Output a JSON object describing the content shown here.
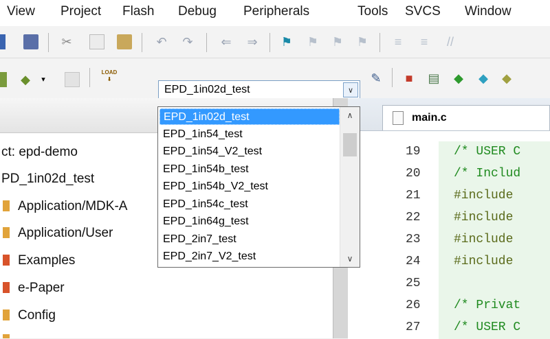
{
  "menu": [
    {
      "label": "View",
      "id": "view"
    },
    {
      "label": "Project",
      "id": "project"
    },
    {
      "label": "Flash",
      "id": "flash"
    },
    {
      "label": "Debug",
      "id": "debug"
    },
    {
      "label": "Peripherals",
      "id": "peripherals"
    },
    {
      "label": "Tools",
      "id": "tools"
    },
    {
      "label": "SVCS",
      "id": "svcs"
    },
    {
      "label": "Window",
      "id": "window"
    }
  ],
  "toolbar2": {
    "load_label": "LOAD",
    "target_value": "EPD_1in02d_test"
  },
  "dropdown": {
    "options": [
      "EPD_1in02d_test",
      "EPD_1in54_test",
      "EPD_1in54_V2_test",
      "EPD_1in54b_test",
      "EPD_1in54b_V2_test",
      "EPD_1in54c_test",
      "EPD_1in64g_test",
      "EPD_2in7_test",
      "EPD_2in7_V2_test"
    ],
    "selected_index": 0
  },
  "project_tree": {
    "project_label": "ct: epd-demo",
    "target_label": "PD_1in02d_test",
    "groups": [
      {
        "label": "Application/MDK-A",
        "color": "#e1a33a"
      },
      {
        "label": "Application/User",
        "color": "#e1a33a"
      },
      {
        "label": "Examples",
        "color": "#d8532a"
      },
      {
        "label": "e-Paper",
        "color": "#d8532a"
      },
      {
        "label": "Config",
        "color": "#e1a33a"
      }
    ]
  },
  "editor": {
    "tab_label": "main.c",
    "lines": [
      {
        "num": "19",
        "text": "/* USER C",
        "kind": "comment"
      },
      {
        "num": "20",
        "text": "/* Includ",
        "kind": "comment"
      },
      {
        "num": "21",
        "text": "#include",
        "kind": "directive"
      },
      {
        "num": "22",
        "text": "#include",
        "kind": "directive"
      },
      {
        "num": "23",
        "text": "#include",
        "kind": "directive"
      },
      {
        "num": "24",
        "text": "#include",
        "kind": "directive"
      },
      {
        "num": "25",
        "text": "",
        "kind": "blank"
      },
      {
        "num": "26",
        "text": "/* Privat",
        "kind": "comment"
      },
      {
        "num": "27",
        "text": "/* USER C",
        "kind": "comment"
      }
    ]
  },
  "colors": {
    "selection": "#3399ff",
    "comment": "#1f8a1f",
    "directive": "#5a6a1a",
    "code_bg": "#eaf6ea"
  }
}
